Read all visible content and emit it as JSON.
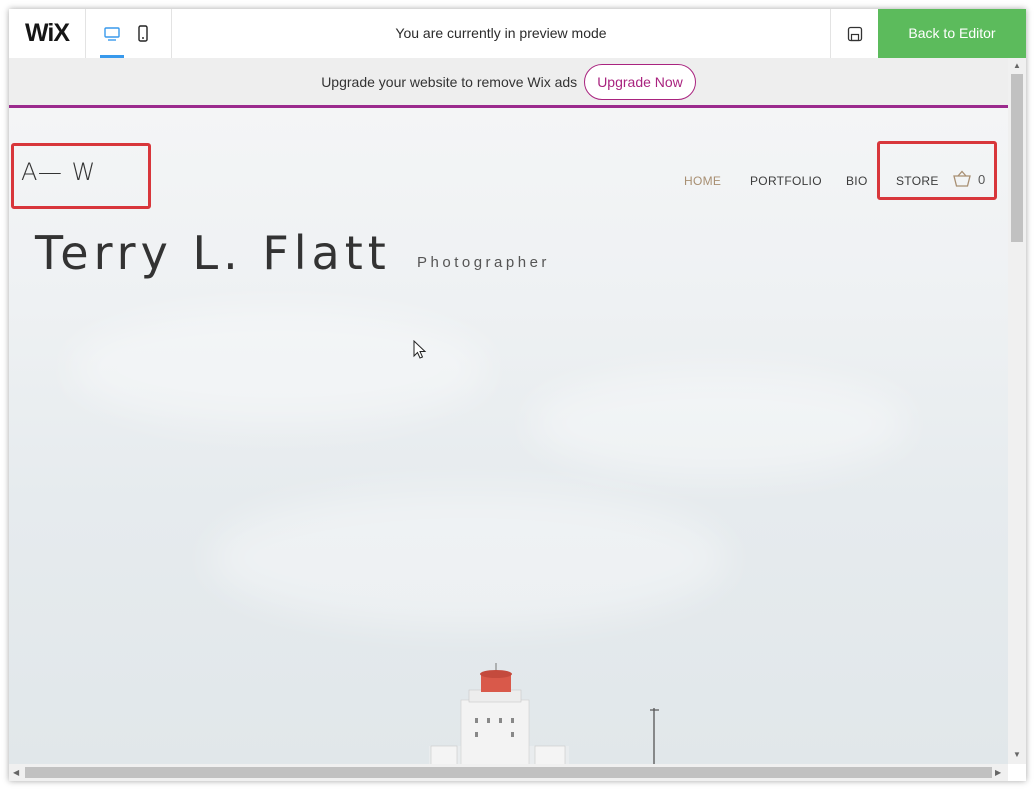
{
  "topbar": {
    "logo": "WiX",
    "preview_text": "You are currently in preview mode",
    "back_label": "Back to Editor",
    "icons": {
      "desktop": "desktop-icon",
      "mobile": "mobile-icon",
      "save": "save-icon"
    }
  },
  "banner": {
    "text": "Upgrade your website to remove Wix ads",
    "button": "Upgrade Now"
  },
  "site": {
    "logo": "A— W",
    "nav": [
      "HOME",
      "PORTFOLIO",
      "BIO",
      "STORE"
    ],
    "cart_count": "0",
    "name": "Terry L. Flatt",
    "role": "Photographer"
  },
  "colors": {
    "accent_green": "#5cbb5c",
    "accent_purple": "#9b2a8d",
    "upgrade_text": "#a9237f",
    "highlight_red": "#d8363b",
    "nav_active": "#a88f72",
    "device_active": "#3899ec"
  }
}
